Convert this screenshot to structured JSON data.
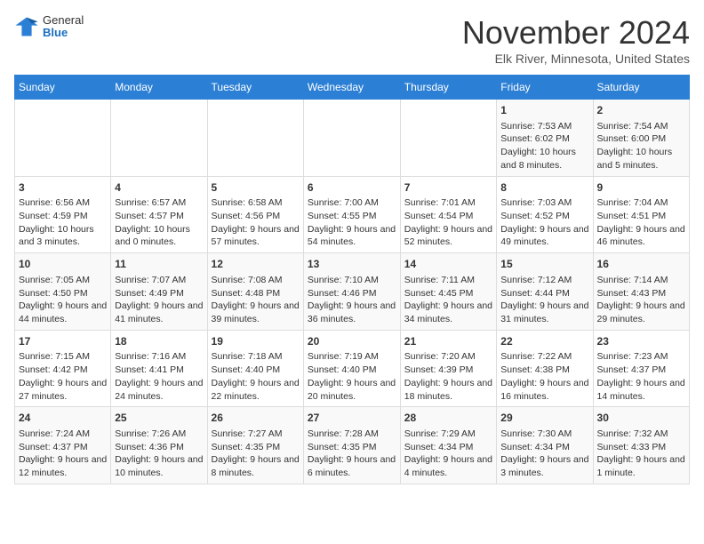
{
  "logo": {
    "general": "General",
    "blue": "Blue"
  },
  "title": "November 2024",
  "location": "Elk River, Minnesota, United States",
  "weekdays": [
    "Sunday",
    "Monday",
    "Tuesday",
    "Wednesday",
    "Thursday",
    "Friday",
    "Saturday"
  ],
  "rows": [
    [
      {
        "day": "",
        "text": ""
      },
      {
        "day": "",
        "text": ""
      },
      {
        "day": "",
        "text": ""
      },
      {
        "day": "",
        "text": ""
      },
      {
        "day": "",
        "text": ""
      },
      {
        "day": "1",
        "text": "Sunrise: 7:53 AM\nSunset: 6:02 PM\nDaylight: 10 hours and 8 minutes."
      },
      {
        "day": "2",
        "text": "Sunrise: 7:54 AM\nSunset: 6:00 PM\nDaylight: 10 hours and 5 minutes."
      }
    ],
    [
      {
        "day": "3",
        "text": "Sunrise: 6:56 AM\nSunset: 4:59 PM\nDaylight: 10 hours and 3 minutes."
      },
      {
        "day": "4",
        "text": "Sunrise: 6:57 AM\nSunset: 4:57 PM\nDaylight: 10 hours and 0 minutes."
      },
      {
        "day": "5",
        "text": "Sunrise: 6:58 AM\nSunset: 4:56 PM\nDaylight: 9 hours and 57 minutes."
      },
      {
        "day": "6",
        "text": "Sunrise: 7:00 AM\nSunset: 4:55 PM\nDaylight: 9 hours and 54 minutes."
      },
      {
        "day": "7",
        "text": "Sunrise: 7:01 AM\nSunset: 4:54 PM\nDaylight: 9 hours and 52 minutes."
      },
      {
        "day": "8",
        "text": "Sunrise: 7:03 AM\nSunset: 4:52 PM\nDaylight: 9 hours and 49 minutes."
      },
      {
        "day": "9",
        "text": "Sunrise: 7:04 AM\nSunset: 4:51 PM\nDaylight: 9 hours and 46 minutes."
      }
    ],
    [
      {
        "day": "10",
        "text": "Sunrise: 7:05 AM\nSunset: 4:50 PM\nDaylight: 9 hours and 44 minutes."
      },
      {
        "day": "11",
        "text": "Sunrise: 7:07 AM\nSunset: 4:49 PM\nDaylight: 9 hours and 41 minutes."
      },
      {
        "day": "12",
        "text": "Sunrise: 7:08 AM\nSunset: 4:48 PM\nDaylight: 9 hours and 39 minutes."
      },
      {
        "day": "13",
        "text": "Sunrise: 7:10 AM\nSunset: 4:46 PM\nDaylight: 9 hours and 36 minutes."
      },
      {
        "day": "14",
        "text": "Sunrise: 7:11 AM\nSunset: 4:45 PM\nDaylight: 9 hours and 34 minutes."
      },
      {
        "day": "15",
        "text": "Sunrise: 7:12 AM\nSunset: 4:44 PM\nDaylight: 9 hours and 31 minutes."
      },
      {
        "day": "16",
        "text": "Sunrise: 7:14 AM\nSunset: 4:43 PM\nDaylight: 9 hours and 29 minutes."
      }
    ],
    [
      {
        "day": "17",
        "text": "Sunrise: 7:15 AM\nSunset: 4:42 PM\nDaylight: 9 hours and 27 minutes."
      },
      {
        "day": "18",
        "text": "Sunrise: 7:16 AM\nSunset: 4:41 PM\nDaylight: 9 hours and 24 minutes."
      },
      {
        "day": "19",
        "text": "Sunrise: 7:18 AM\nSunset: 4:40 PM\nDaylight: 9 hours and 22 minutes."
      },
      {
        "day": "20",
        "text": "Sunrise: 7:19 AM\nSunset: 4:40 PM\nDaylight: 9 hours and 20 minutes."
      },
      {
        "day": "21",
        "text": "Sunrise: 7:20 AM\nSunset: 4:39 PM\nDaylight: 9 hours and 18 minutes."
      },
      {
        "day": "22",
        "text": "Sunrise: 7:22 AM\nSunset: 4:38 PM\nDaylight: 9 hours and 16 minutes."
      },
      {
        "day": "23",
        "text": "Sunrise: 7:23 AM\nSunset: 4:37 PM\nDaylight: 9 hours and 14 minutes."
      }
    ],
    [
      {
        "day": "24",
        "text": "Sunrise: 7:24 AM\nSunset: 4:37 PM\nDaylight: 9 hours and 12 minutes."
      },
      {
        "day": "25",
        "text": "Sunrise: 7:26 AM\nSunset: 4:36 PM\nDaylight: 9 hours and 10 minutes."
      },
      {
        "day": "26",
        "text": "Sunrise: 7:27 AM\nSunset: 4:35 PM\nDaylight: 9 hours and 8 minutes."
      },
      {
        "day": "27",
        "text": "Sunrise: 7:28 AM\nSunset: 4:35 PM\nDaylight: 9 hours and 6 minutes."
      },
      {
        "day": "28",
        "text": "Sunrise: 7:29 AM\nSunset: 4:34 PM\nDaylight: 9 hours and 4 minutes."
      },
      {
        "day": "29",
        "text": "Sunrise: 7:30 AM\nSunset: 4:34 PM\nDaylight: 9 hours and 3 minutes."
      },
      {
        "day": "30",
        "text": "Sunrise: 7:32 AM\nSunset: 4:33 PM\nDaylight: 9 hours and 1 minute."
      }
    ]
  ]
}
